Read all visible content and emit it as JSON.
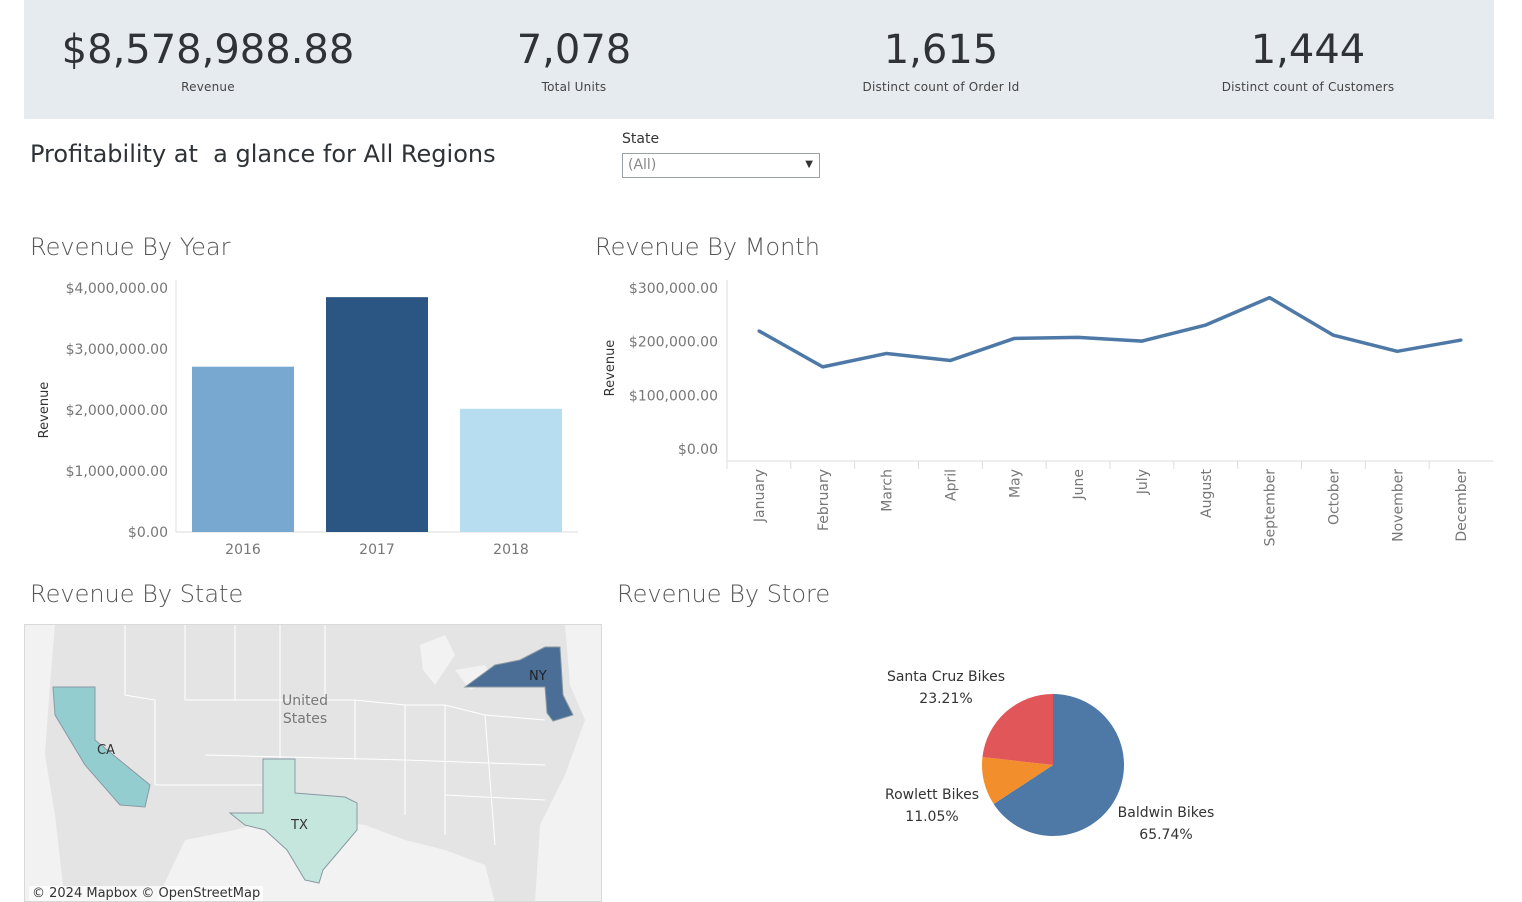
{
  "kpis": [
    {
      "value": "$8,578,988.88",
      "label": "Revenue"
    },
    {
      "value": "7,078",
      "label": "Total Units"
    },
    {
      "value": "1,615",
      "label": "Distinct count of Order Id"
    },
    {
      "value": "1,444",
      "label": "Distinct count of Customers"
    }
  ],
  "heading": "Profitability at  a glance for All Regions",
  "filter": {
    "label": "State",
    "value": "(All)"
  },
  "titles": {
    "by_year": "Revenue By Year",
    "by_month": "Revenue By Month",
    "by_state": "Revenue By State",
    "by_store": "Revenue By Store"
  },
  "map": {
    "states": [
      {
        "code": "CA",
        "color": "#93cdd0"
      },
      {
        "code": "TX",
        "color": "#c5e6dd"
      },
      {
        "code": "NY",
        "color": "#4a6e96"
      }
    ],
    "country_label_line1": "United",
    "country_label_line2": "States",
    "attribution": "© 2024 Mapbox  © OpenStreetMap"
  },
  "colors": {
    "line": "#4e79a7",
    "bar_2016": "#78a8cf",
    "bar_2017": "#2b5683",
    "bar_2018": "#b7ddf0",
    "pie_baldwin": "#4e79a7",
    "pie_rowlett": "#f28e2b",
    "pie_santa_cruz": "#e15759"
  },
  "chart_data": [
    {
      "type": "bar",
      "id": "by_year",
      "categories": [
        "2016",
        "2017",
        "2018"
      ],
      "values": [
        2710000,
        3850000,
        2020000
      ],
      "ylabel": "Revenue",
      "ylim": [
        0,
        4000000
      ],
      "yticks": [
        0,
        1000000,
        2000000,
        3000000,
        4000000
      ],
      "ytick_labels": [
        "$0.00",
        "$1,000,000.00",
        "$2,000,000.00",
        "$3,000,000.00",
        "$4,000,000.00"
      ]
    },
    {
      "type": "line",
      "id": "by_month",
      "categories": [
        "January",
        "February",
        "March",
        "April",
        "May",
        "June",
        "July",
        "August",
        "September",
        "October",
        "November",
        "December"
      ],
      "values": [
        220000,
        153000,
        178000,
        165000,
        206000,
        208000,
        201000,
        231000,
        282000,
        212000,
        182000,
        203000
      ],
      "ylabel": "Revenue",
      "ylim": [
        0,
        300000
      ],
      "yticks": [
        0,
        100000,
        200000,
        300000
      ],
      "ytick_labels": [
        "$0.00",
        "$100,000.00",
        "$200,000.00",
        "$300,000.00"
      ]
    },
    {
      "type": "pie",
      "id": "by_store",
      "labels": [
        "Baldwin Bikes",
        "Rowlett Bikes",
        "Santa Cruz Bikes"
      ],
      "values": [
        65.74,
        11.05,
        23.21
      ],
      "value_labels": [
        "65.74%",
        "11.05%",
        "23.21%"
      ]
    }
  ]
}
